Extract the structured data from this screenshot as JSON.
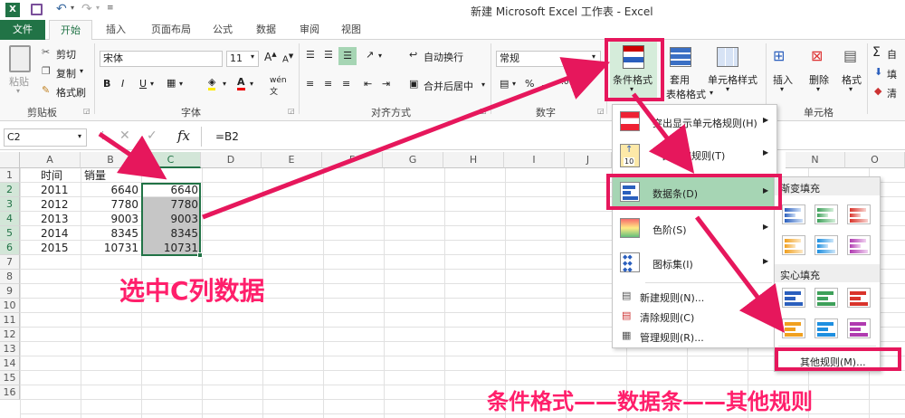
{
  "window": {
    "title": "新建 Microsoft Excel 工作表 - Excel"
  },
  "tabs": [
    "文件",
    "开始",
    "插入",
    "页面布局",
    "公式",
    "数据",
    "审阅",
    "视图"
  ],
  "ribbon": {
    "clipboard": {
      "paste": "粘贴",
      "cut": "剪切",
      "copy": "复制",
      "painter": "格式刷",
      "label": "剪贴板"
    },
    "font": {
      "name": "宋体",
      "size": "11",
      "label": "字体",
      "bold": "B",
      "italic": "I",
      "underline": "U"
    },
    "align": {
      "wrap": "自动换行",
      "merge": "合并后居中",
      "label": "对齐方式"
    },
    "number": {
      "format": "常规",
      "label": "数字"
    },
    "styles": {
      "cond": "条件格式",
      "table_a": "套用",
      "table_b": "表格格式",
      "cell": "单元格样式"
    },
    "cells": {
      "insert": "插入",
      "delete": "删除",
      "format": "格式",
      "label": "单元格"
    },
    "editing": {
      "sum": "自",
      "fill": "填",
      "clear": "清"
    }
  },
  "formula": {
    "namebox": "C2",
    "fx": "fx",
    "content": "=B2"
  },
  "columns": [
    "A",
    "B",
    "C",
    "D",
    "E",
    "F",
    "G",
    "H",
    "I",
    "J",
    "N",
    "O"
  ],
  "rows": [
    "1",
    "2",
    "3",
    "4",
    "5",
    "6",
    "7",
    "8",
    "9",
    "10",
    "11",
    "12",
    "13",
    "14",
    "15",
    "16"
  ],
  "table": {
    "header": [
      "时间",
      "销量"
    ],
    "data": [
      [
        "2011",
        "6640",
        "6640"
      ],
      [
        "2012",
        "7780",
        "7780"
      ],
      [
        "2013",
        "9003",
        "9003"
      ],
      [
        "2014",
        "8345",
        "8345"
      ],
      [
        "2015",
        "10731",
        "10731"
      ]
    ]
  },
  "menu": {
    "highlight": "突出显示单元格规则(H)",
    "topbottom": "项目选取规则(T)",
    "topbottom_visible": "目选取规则(T)",
    "topbottom_icon_text": "10",
    "databar": "数据条(D)",
    "colorscale": "色阶(S)",
    "iconset": "图标集(I)",
    "newrule": "新建规则(N)...",
    "clearrule": "清除规则(C)",
    "managerule": "管理规则(R)..."
  },
  "submenu": {
    "gradient": "渐变填充",
    "solid": "实心填充",
    "more": "其他规则(M)..."
  },
  "annotations": {
    "select": "选中C列数据",
    "path": "条件格式——数据条——其他规则"
  },
  "colors": {
    "excel_green": "#217346",
    "accent": "#e6175c",
    "annotation": "#ff1f6b"
  }
}
